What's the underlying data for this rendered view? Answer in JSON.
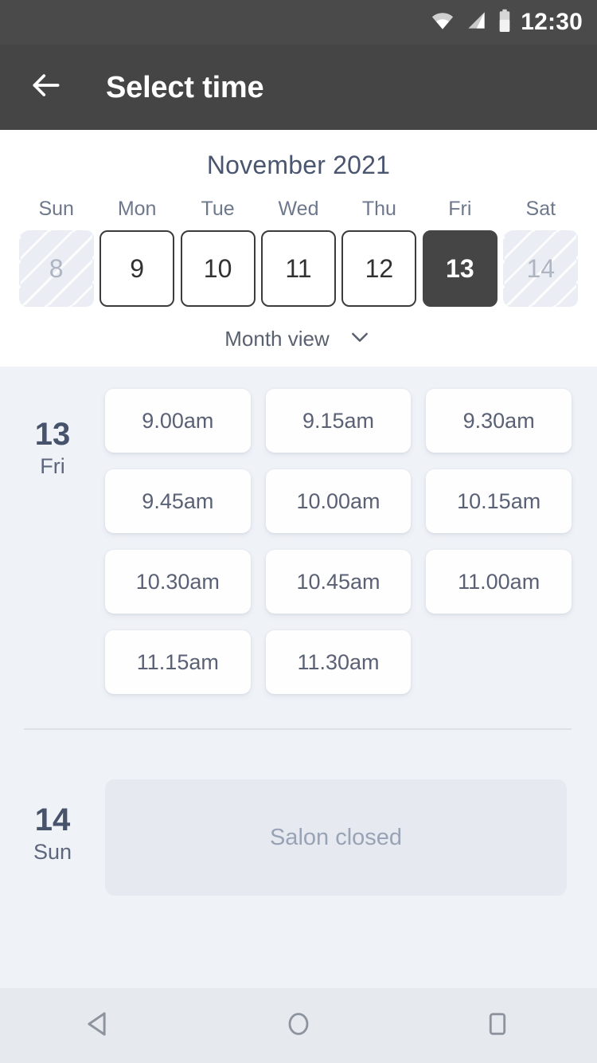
{
  "status_bar": {
    "time": "12:30",
    "icons": [
      "wifi-icon",
      "signal-icon",
      "battery-icon"
    ]
  },
  "toolbar": {
    "title": "Select time",
    "back_icon": "arrow-left-icon"
  },
  "calendar": {
    "month_title": "November 2021",
    "weekdays": [
      "Sun",
      "Mon",
      "Tue",
      "Wed",
      "Thu",
      "Fri",
      "Sat"
    ],
    "days": [
      {
        "num": "8",
        "state": "disabled"
      },
      {
        "num": "9",
        "state": "enabled"
      },
      {
        "num": "10",
        "state": "enabled"
      },
      {
        "num": "11",
        "state": "enabled"
      },
      {
        "num": "12",
        "state": "enabled"
      },
      {
        "num": "13",
        "state": "selected"
      },
      {
        "num": "14",
        "state": "disabled"
      }
    ],
    "view_toggle_label": "Month view",
    "view_toggle_icon": "chevron-down-icon"
  },
  "schedule": [
    {
      "day_number": "13",
      "day_of_week": "Fri",
      "slots": [
        "9.00am",
        "9.15am",
        "9.30am",
        "9.45am",
        "10.00am",
        "10.15am",
        "10.30am",
        "10.45am",
        "11.00am",
        "11.15am",
        "11.30am"
      ],
      "closed_message": null
    },
    {
      "day_number": "14",
      "day_of_week": "Sun",
      "slots": [],
      "closed_message": "Salon closed"
    }
  ],
  "nav_bar": {
    "buttons": [
      "back-triangle-icon",
      "home-circle-icon",
      "recents-square-icon"
    ]
  },
  "colors": {
    "toolbar_bg": "#454545",
    "status_bg": "#4a4a4a",
    "page_bg": "#eff2f7",
    "panel_bg": "#ffffff",
    "accent_text": "#4a5570",
    "selected_day_bg": "#454545",
    "slot_bg": "#fefefe",
    "closed_bg": "#e6eaf0"
  }
}
